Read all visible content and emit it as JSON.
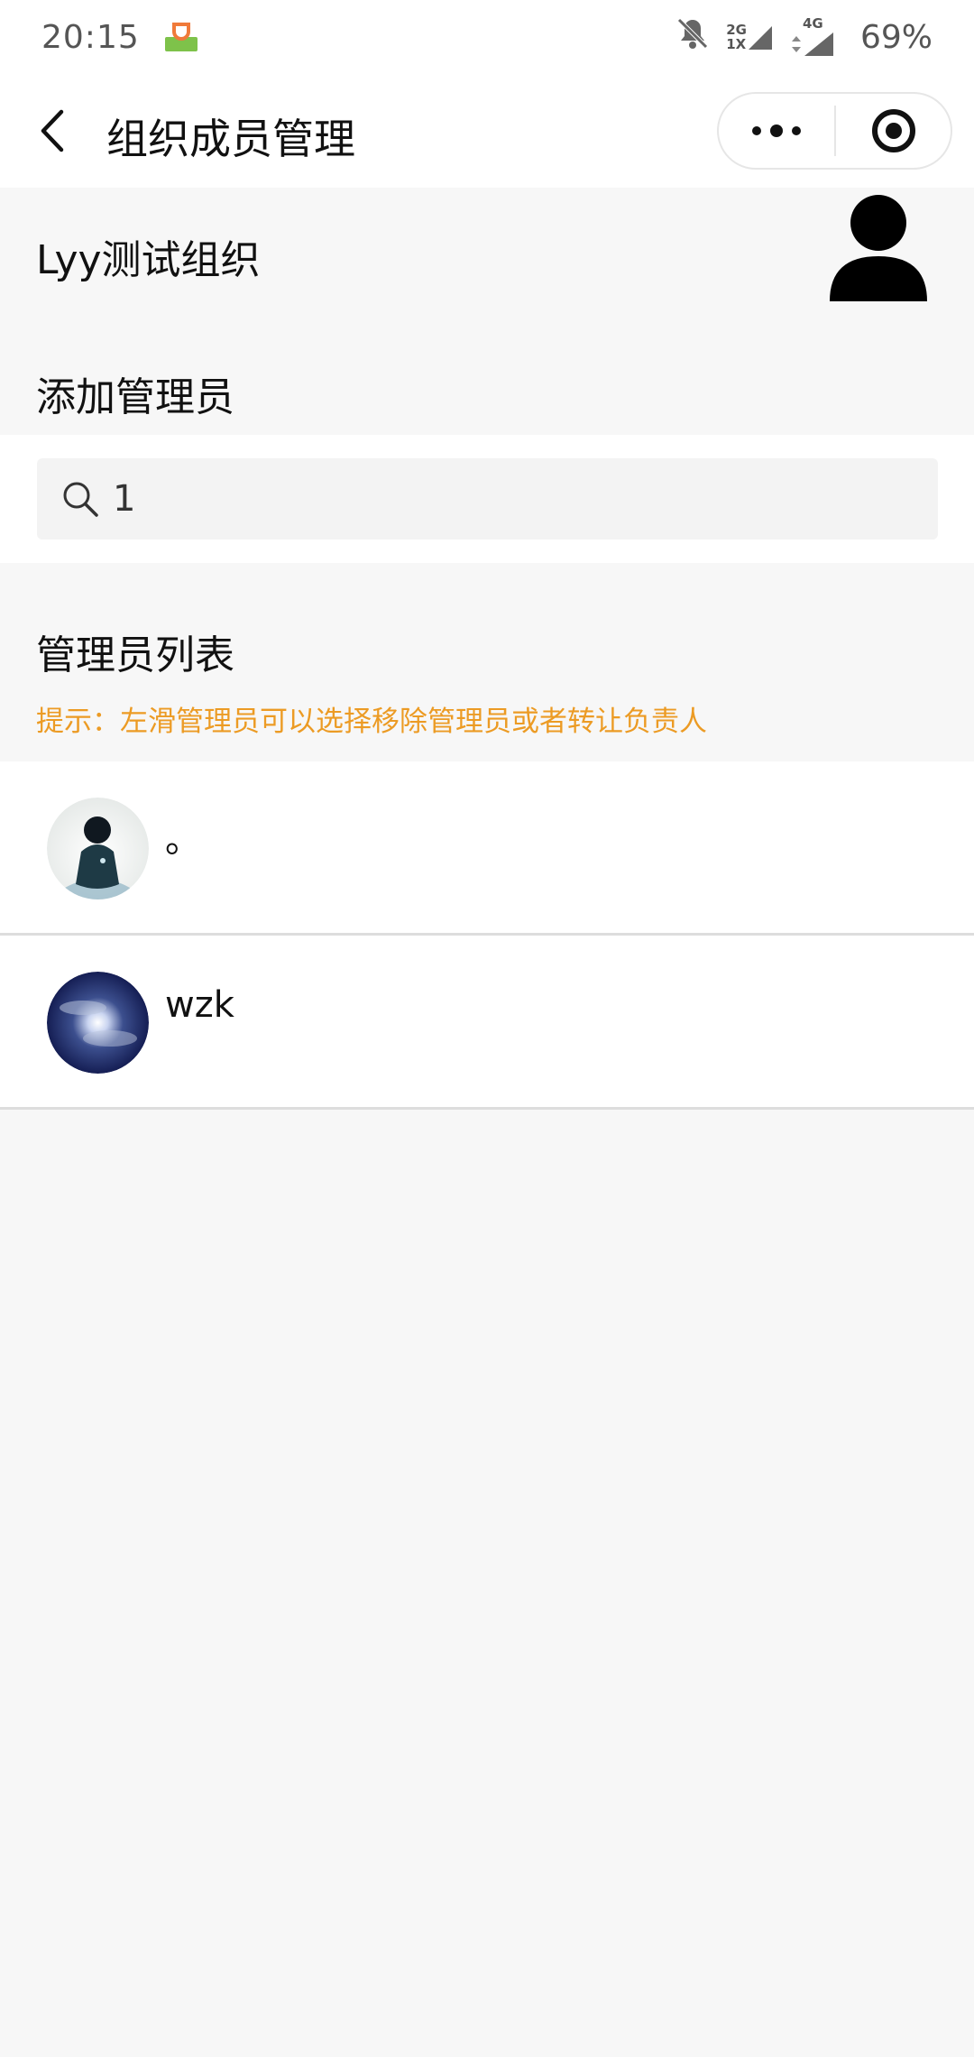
{
  "status_bar": {
    "time": "20:15",
    "battery": "69%",
    "network_1": "2G",
    "network_1_sub": "1X",
    "network_2": "4G"
  },
  "nav": {
    "title": "组织成员管理"
  },
  "org": {
    "name": "Lyy测试组织"
  },
  "add_admin": {
    "label": "添加管理员"
  },
  "search": {
    "value": "1"
  },
  "admin_list": {
    "label": "管理员列表",
    "hint": "提示：左滑管理员可以选择移除管理员或者转让负责人",
    "members": [
      {
        "name": "。"
      },
      {
        "name": "wzk"
      }
    ]
  },
  "colors": {
    "hint": "#ec9b24",
    "page_bg": "#f7f7f7"
  }
}
